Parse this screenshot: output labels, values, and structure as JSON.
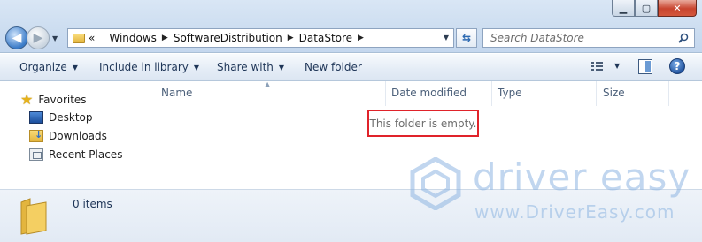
{
  "window": {
    "minimize_glyph": "▁",
    "maximize_glyph": "▢",
    "close_glyph": "✕"
  },
  "nav": {
    "back_glyph": "◀",
    "forward_glyph": "▶",
    "history_glyph": "▼"
  },
  "address": {
    "overflow": "«",
    "breadcrumbs": [
      "Windows",
      "SoftwareDistribution",
      "DataStore"
    ],
    "separator": "▶",
    "dropdown_glyph": "▼"
  },
  "refresh_glyph": "⇆",
  "search": {
    "placeholder": "Search DataStore"
  },
  "toolbar": {
    "organize": "Organize",
    "include_in_library": "Include in library",
    "share_with": "Share with",
    "new_folder": "New folder",
    "caret": "▼",
    "help": "?"
  },
  "navpane": {
    "favorites": "Favorites",
    "items": [
      {
        "label": "Desktop",
        "icon": "desktop-icon"
      },
      {
        "label": "Downloads",
        "icon": "downloads-icon"
      },
      {
        "label": "Recent Places",
        "icon": "recent-places-icon"
      }
    ]
  },
  "columns": [
    "Name",
    "Date modified",
    "Type",
    "Size"
  ],
  "sort_indicator": "▲",
  "empty_message": "This folder is empty.",
  "details": {
    "items": "0 items"
  },
  "watermark": {
    "brand": "driver easy",
    "url": "www.DriverEasy.com"
  },
  "colors": {
    "highlight_border": "#e0232a",
    "accent": "#2c69b1"
  }
}
